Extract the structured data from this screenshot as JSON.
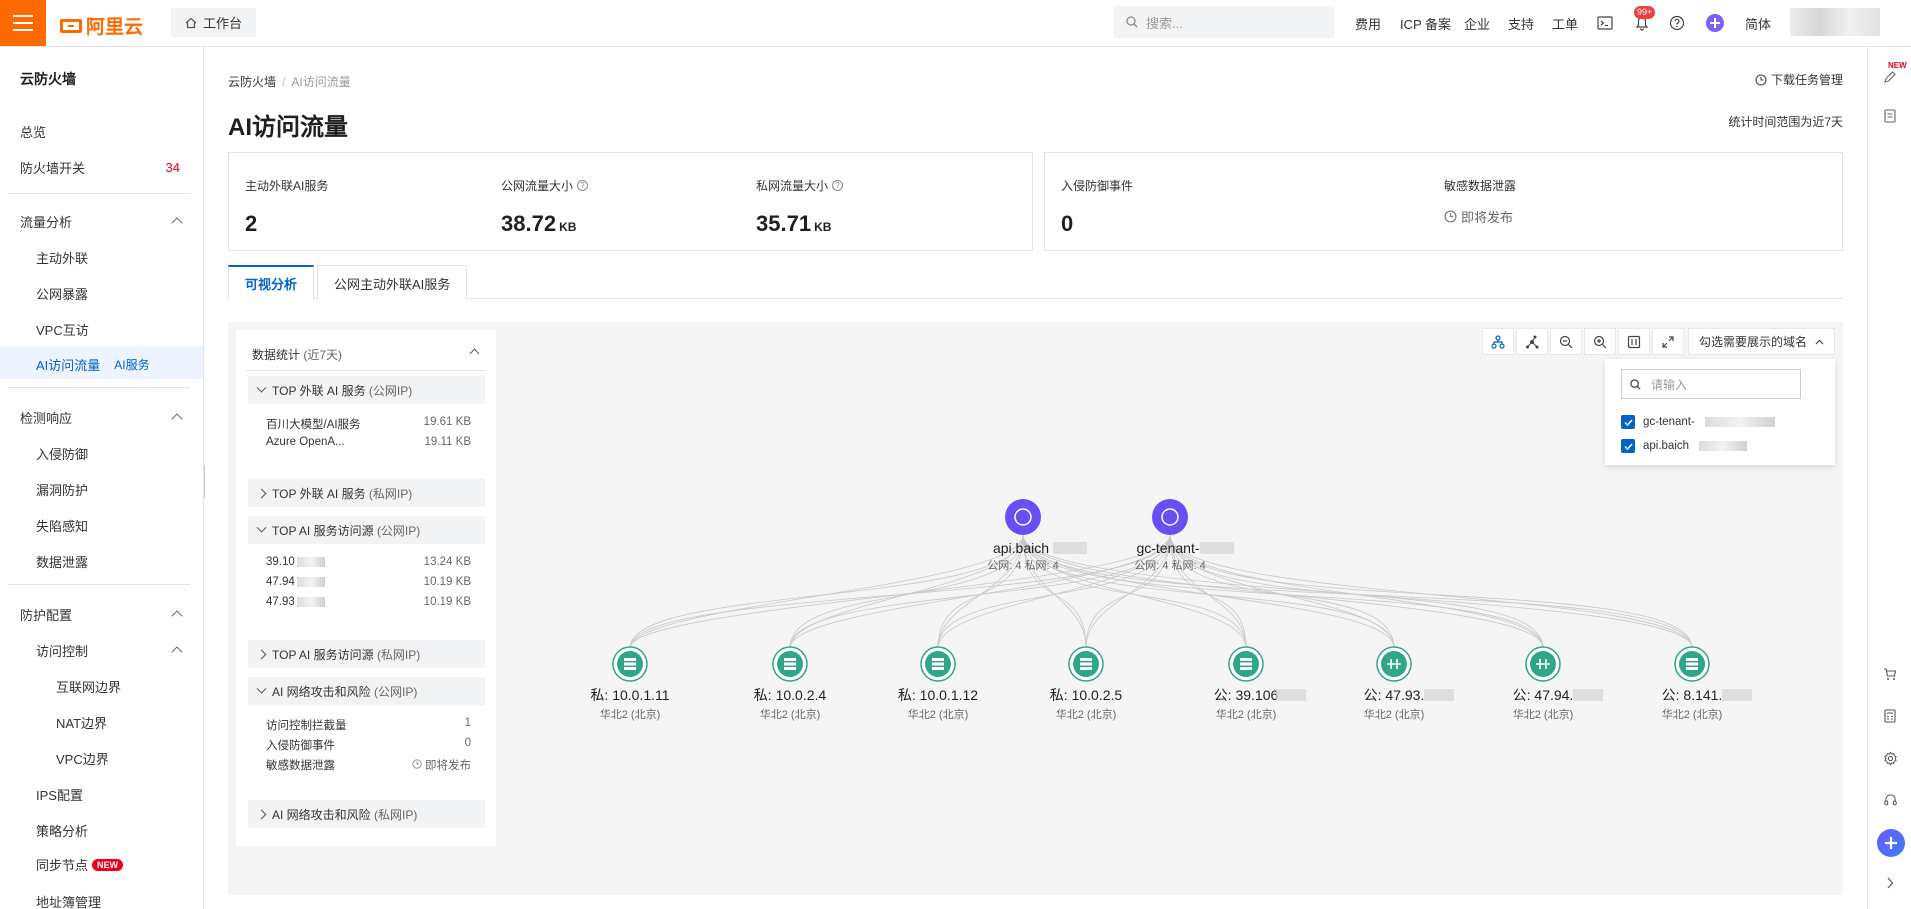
{
  "topbar": {
    "logo_text": "阿里云",
    "workbench": "工作台",
    "search_placeholder": "搜索...",
    "nav": [
      "费用",
      "ICP 备案",
      "企业",
      "支持",
      "工单"
    ],
    "notif_badge": "99+",
    "lang": "简体"
  },
  "sidebar": {
    "title": "云防火墙",
    "overview": "总览",
    "fw_switch": "防火墙开关",
    "fw_switch_count": "34",
    "traffic": "流量分析",
    "outbound": "主动外联",
    "exposure": "公网暴露",
    "vpc": "VPC互访",
    "ai_traffic": "AI访问流量",
    "ai_service": "AI服务",
    "detect": "检测响应",
    "intrusion": "入侵防御",
    "vuln": "漏洞防护",
    "honeypot": "失陷感知",
    "leak": "数据泄露",
    "protect": "防护配置",
    "access": "访问控制",
    "internet_edge": "互联网边界",
    "nat_edge": "NAT边界",
    "vpc_edge": "VPC边界",
    "ips": "IPS配置",
    "policy": "策略分析",
    "sync": "同步节点",
    "new_tag": "NEW",
    "address_book": "地址簿管理"
  },
  "page": {
    "crumb_root": "云防火墙",
    "crumb_current": "AI访问流量",
    "download": "下载任务管理",
    "title": "AI访问流量",
    "range": "统计时间范围为近7天"
  },
  "stats": {
    "ai_services_label": "主动外联AI服务",
    "ai_services_value": "2",
    "public_label": "公网流量大小",
    "public_value": "38.72",
    "public_unit": "KB",
    "private_label": "私网流量大小",
    "private_value": "35.71",
    "private_unit": "KB",
    "intrusion_label": "入侵防御事件",
    "intrusion_value": "0",
    "leak_label": "敏感数据泄露",
    "leak_value": "即将发布"
  },
  "tabs": [
    "可视分析",
    "公网主动外联AI服务"
  ],
  "data_stats": {
    "title": "数据统计",
    "period": "(近7天)",
    "s1": "TOP 外联 AI 服务",
    "s1_sub": "(公网IP)",
    "s1_rows": [
      {
        "name": "百川大模型/AI服务",
        "value": "19.61 KB"
      },
      {
        "name": "Azure OpenA...",
        "value": "19.11 KB"
      }
    ],
    "s2": "TOP 外联 AI 服务",
    "s2_sub": "(私网IP)",
    "s3": "TOP AI 服务访问源",
    "s3_sub": "(公网IP)",
    "s3_rows": [
      {
        "name": "39.10",
        "value": "13.24 KB"
      },
      {
        "name": "47.94",
        "value": "10.19 KB"
      },
      {
        "name": "47.93",
        "value": "10.19 KB"
      }
    ],
    "s4": "TOP AI 服务访问源",
    "s4_sub": "(私网IP)",
    "s5": "AI 网络攻击和风险",
    "s5_sub": "(公网IP)",
    "s5_rows": [
      {
        "name": "访问控制拦截量",
        "value": "1"
      },
      {
        "name": "入侵防御事件",
        "value": "0"
      },
      {
        "name": "敏感数据泄露",
        "value": "即将发布"
      }
    ],
    "s6": "AI 网络攻击和风险",
    "s6_sub": "(私网IP)"
  },
  "domain_filter": {
    "label": "勾选需要展示的域名",
    "placeholder": "请输入",
    "options": [
      "gc-tenant-",
      "api.baich"
    ]
  },
  "graph": {
    "ai_nodes": [
      {
        "name": "api.baich",
        "sub": "公网: 4 私网: 4"
      },
      {
        "name": "gc-tenant-",
        "sub": "公网: 4 私网: 4"
      }
    ],
    "src_nodes": [
      {
        "label": "私: 10.0.1.11",
        "region": "华北2 (北京)",
        "icon": "server"
      },
      {
        "label": "私: 10.0.2.4",
        "region": "华北2 (北京)",
        "icon": "server"
      },
      {
        "label": "私: 10.0.1.12",
        "region": "华北2 (北京)",
        "icon": "server"
      },
      {
        "label": "私: 10.0.2.5",
        "region": "华北2 (北京)",
        "icon": "server"
      },
      {
        "label": "公: 39.106",
        "region": "华北2 (北京)",
        "icon": "server"
      },
      {
        "label": "公: 47.93.",
        "region": "华北2 (北京)",
        "icon": "gateway"
      },
      {
        "label": "公: 47.94.",
        "region": "华北2 (北京)",
        "icon": "gateway"
      },
      {
        "label": "公: 8.141.",
        "region": "华北2 (北京)",
        "icon": "server"
      }
    ]
  }
}
